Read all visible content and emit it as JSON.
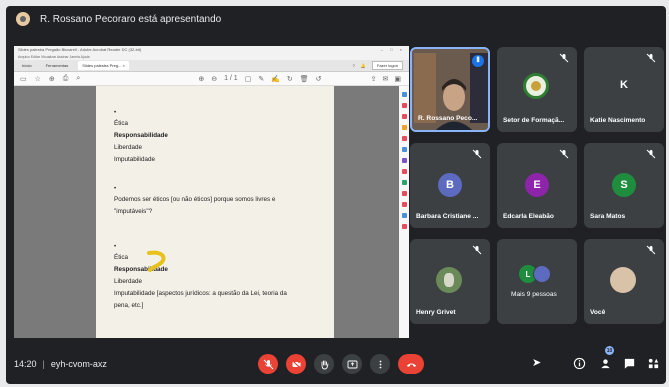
{
  "presenter_bar": {
    "text": "R. Rossano Pecoraro está apresentando"
  },
  "shared_window": {
    "title": "Slides palestra Pregaão Biccarell - Adobe Acrobat Reader DC (32-bit)",
    "menu": "Arquivo  Editar  Visualizar  Assinar  Janela  Ajuda",
    "tabs": [
      "Início",
      "Ferramentas",
      "Slides palestra Preg... ×"
    ],
    "login_label": "Fazer logon",
    "page_counter": "1 / 1"
  },
  "document": {
    "block1": [
      "Ética",
      "Responsabilidade",
      "Liberdade",
      "Imputabilidade"
    ],
    "block2_line1": "Podemos ser éticos [ou não éticos] porque somos livres e",
    "block2_line2": "\"imputáveis\"?",
    "block3": [
      "Ética",
      "Responsabilidade",
      "Liberdade"
    ],
    "block3_line4": "Imputabilidade [aspectos jurídicos: a questão da Lei, teoria da",
    "block3_line5": "pena, etc.]",
    "bullet": "•"
  },
  "participants": [
    {
      "name": "R. Rossano Peco...",
      "kind": "video",
      "speaking": true
    },
    {
      "name": "Setor de Formaçã...",
      "kind": "logo",
      "muted": true
    },
    {
      "name": "Katie Nascimento",
      "initial": "K",
      "color": "#3c4043",
      "muted": true
    },
    {
      "name": "Barbara Cristiane ...",
      "initial": "B",
      "color": "#5c6bc0",
      "muted": true
    },
    {
      "name": "Edcarla Eleabão",
      "initial": "E",
      "color": "#8e24aa",
      "muted": true
    },
    {
      "name": "Sara Matos",
      "initial": "S",
      "color": "#1e8e3e",
      "muted": true
    },
    {
      "name": "Henry Grivet",
      "kind": "photo",
      "muted": true
    },
    {
      "name": "Mais 9 pessoas",
      "kind": "group"
    },
    {
      "name": "Você",
      "kind": "photo",
      "muted": true
    }
  ],
  "bottom_bar": {
    "time": "14:20",
    "meeting_code": "eyh-cvom-axz",
    "people_badge": "10"
  },
  "colors": {
    "danger": "#ea4335",
    "speaking": "#8ab4f8",
    "background": "#202124",
    "tile": "#3c4043"
  }
}
